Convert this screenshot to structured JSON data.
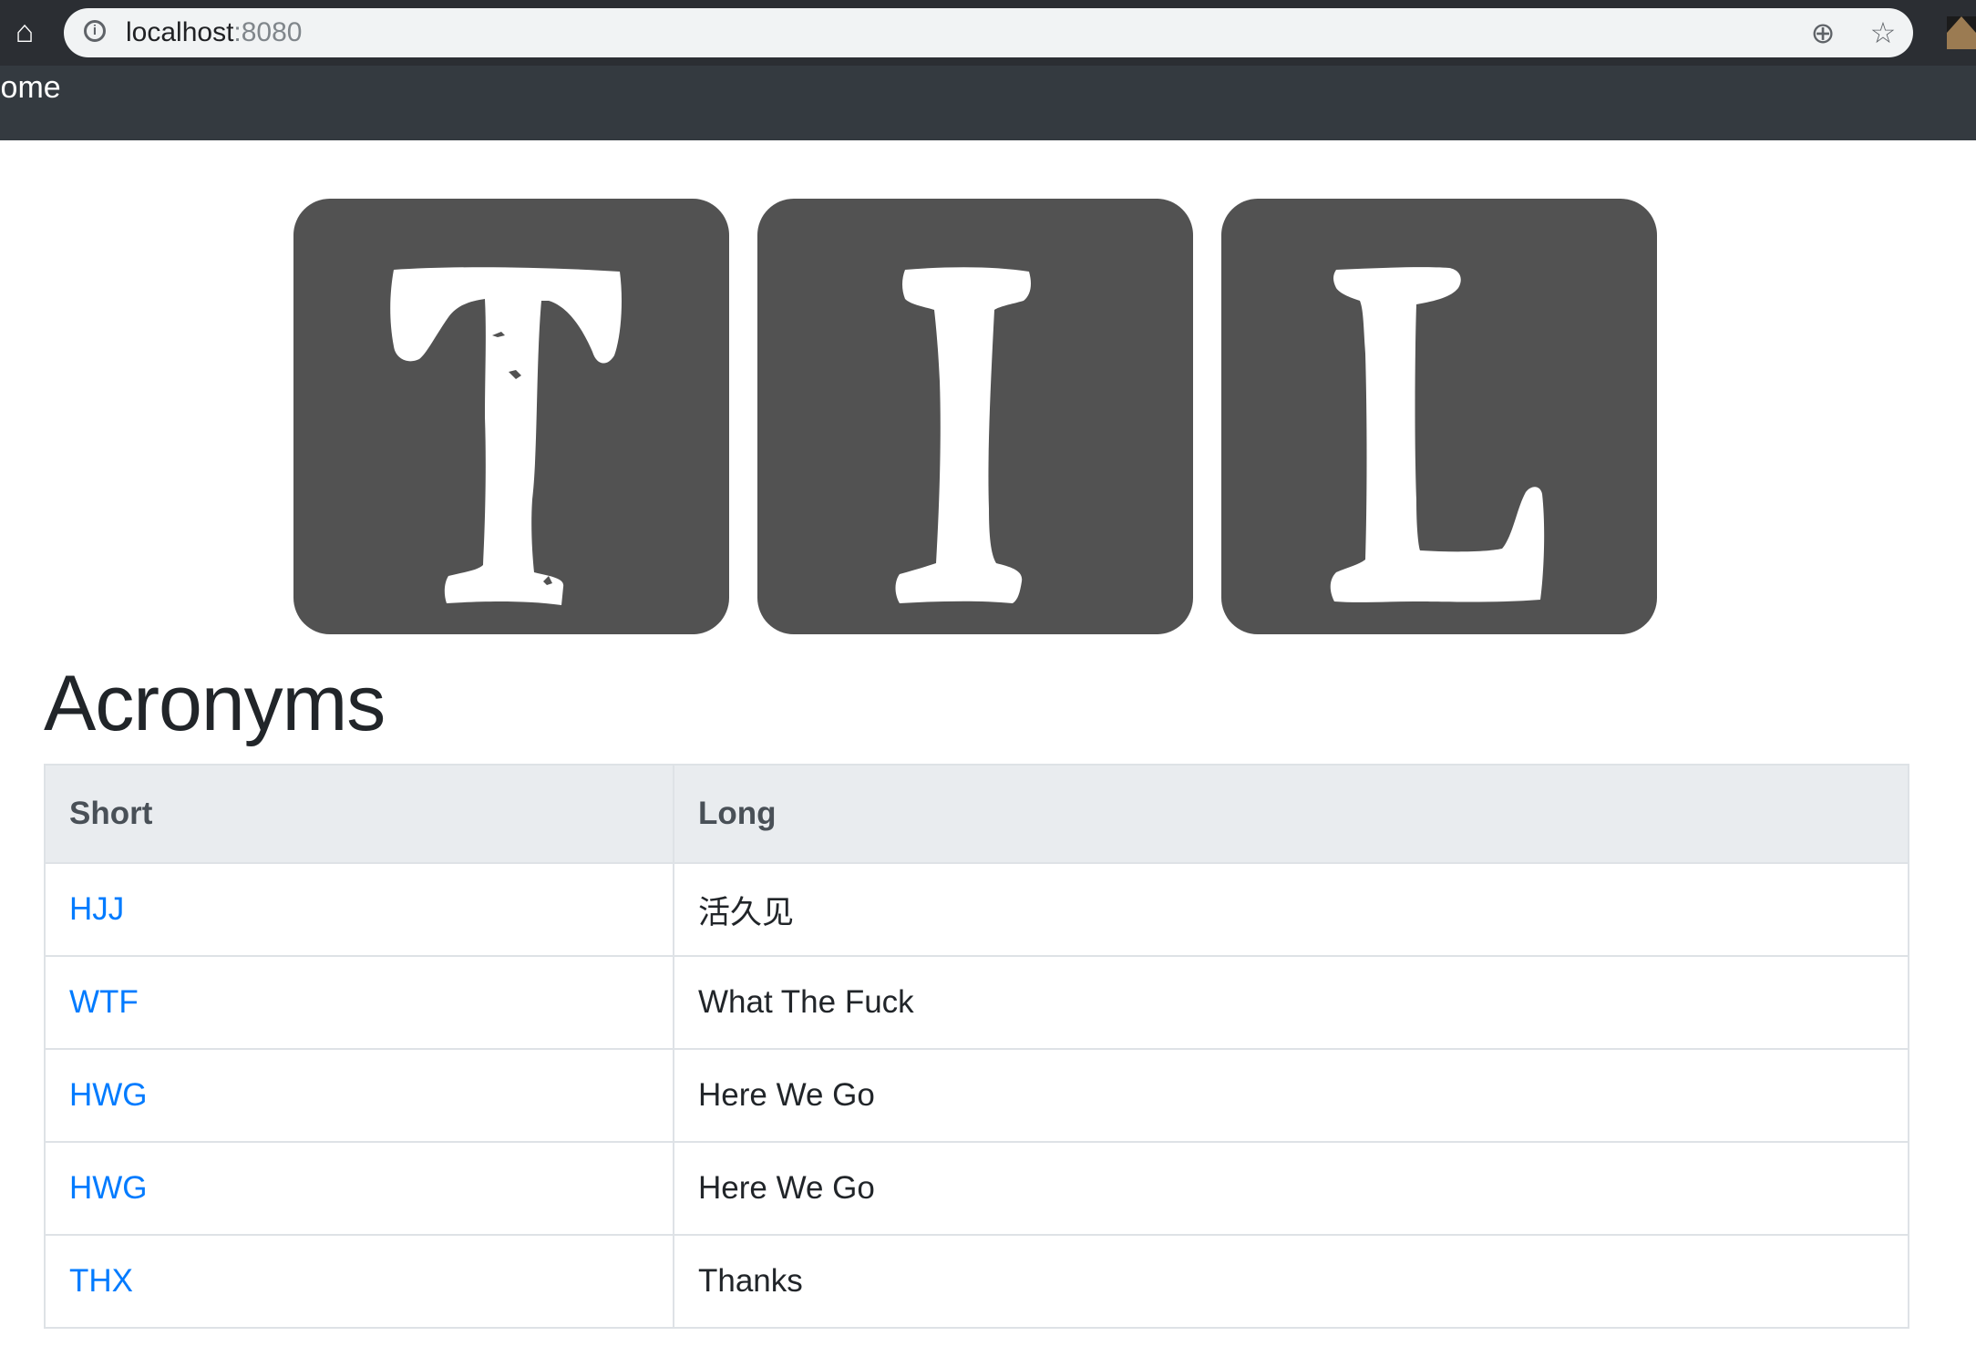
{
  "browser": {
    "url_host": "localhost",
    "url_port": ":8080",
    "icons": [
      "home-icon",
      "info-icon",
      "zoom-icon",
      "star-icon"
    ]
  },
  "navbar": {
    "home_label": "Home"
  },
  "logo": {
    "letters": [
      "T",
      "I",
      "L"
    ],
    "tile_color": "#525252"
  },
  "page": {
    "title": "Acronyms"
  },
  "table": {
    "headers": {
      "short": "Short",
      "long": "Long"
    },
    "rows": [
      {
        "short": "HJJ",
        "long": "活久见"
      },
      {
        "short": "WTF",
        "long": "What The Fuck"
      },
      {
        "short": "HWG",
        "long": "Here We Go"
      },
      {
        "short": "HWG",
        "long": "Here We Go"
      },
      {
        "short": "THX",
        "long": "Thanks"
      }
    ]
  },
  "colors": {
    "navbar": "#343a40",
    "link": "#007bff",
    "header_bg": "#e9ecef"
  }
}
